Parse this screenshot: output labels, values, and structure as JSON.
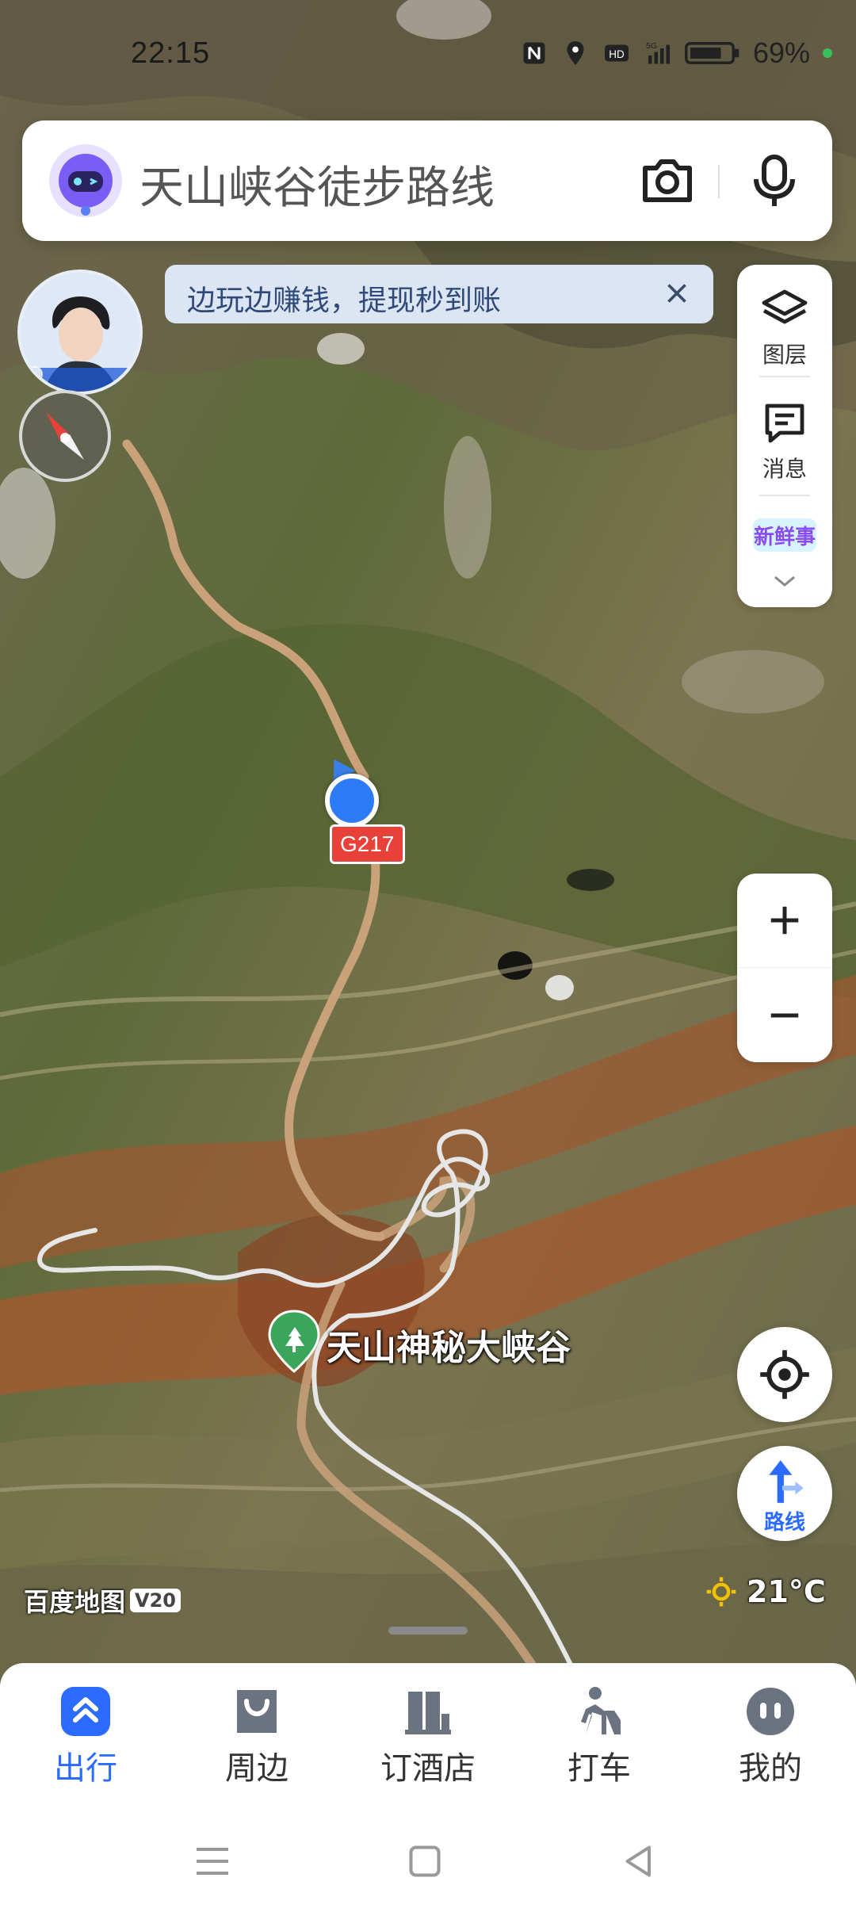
{
  "status_bar": {
    "time": "22:15",
    "battery": "69%",
    "icons": [
      "nfc-icon",
      "location-icon",
      "hd-icon",
      "signal-5g-icon",
      "battery-icon"
    ]
  },
  "search": {
    "query": "天山峡谷徒步路线",
    "avatar_icon": "robot-assistant-icon",
    "camera_icon": "camera-icon",
    "mic_icon": "microphone-icon"
  },
  "promo": {
    "text": "边玩边赚钱，提现秒到账",
    "close_icon": "close-icon"
  },
  "tools": [
    {
      "label": "图层",
      "icon": "layers-icon"
    },
    {
      "label": "消息",
      "icon": "message-icon"
    }
  ],
  "news_badge": "新鲜事",
  "map": {
    "road_shield": "G217",
    "poi_name": "天山神秘大峡谷",
    "logo": "百度地图",
    "logo_version": "V20",
    "temperature": "21°C"
  },
  "route_button": {
    "label": "路线"
  },
  "nav": [
    {
      "label": "出行",
      "icon": "travel-icon",
      "active": true
    },
    {
      "label": "周边",
      "icon": "nearby-icon",
      "active": false
    },
    {
      "label": "订酒店",
      "icon": "hotel-icon",
      "active": false
    },
    {
      "label": "打车",
      "icon": "taxi-icon",
      "active": false
    },
    {
      "label": "我的",
      "icon": "profile-icon",
      "active": false
    }
  ],
  "colors": {
    "accent": "#2c6bff",
    "road_shield": "#e8413a",
    "user_location": "#2d7bf6",
    "poi_pin": "#3aa55b"
  }
}
